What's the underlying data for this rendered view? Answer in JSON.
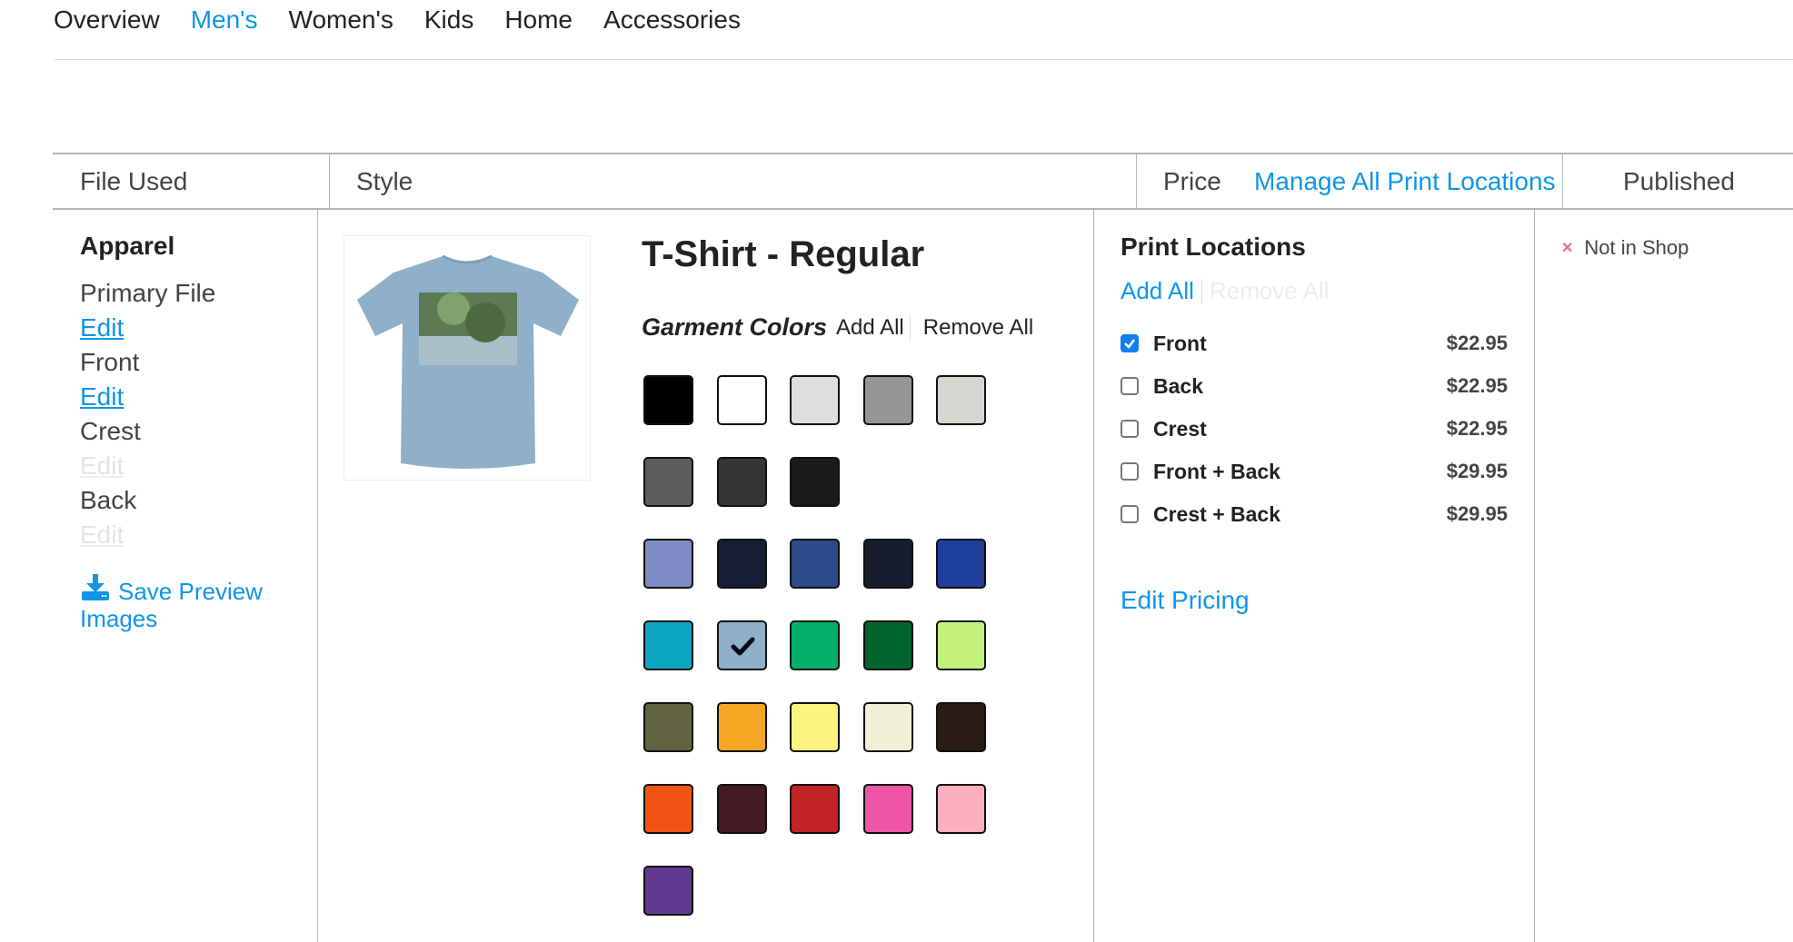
{
  "nav": {
    "tabs": [
      {
        "label": "Overview",
        "active": false
      },
      {
        "label": "Men's",
        "active": true
      },
      {
        "label": "Women's",
        "active": false
      },
      {
        "label": "Kids",
        "active": false
      },
      {
        "label": "Home",
        "active": false
      },
      {
        "label": "Accessories",
        "active": false
      }
    ]
  },
  "table_header": {
    "file_used": "File Used",
    "style": "Style",
    "price": "Price",
    "manage_all": "Manage All Print Locations",
    "published": "Published"
  },
  "file_used": {
    "section": "Apparel",
    "items": [
      {
        "label": "Primary File",
        "edit": "Edit",
        "enabled": true
      },
      {
        "label": "Front",
        "edit": "Edit",
        "enabled": true
      },
      {
        "label": "Crest",
        "edit": "Edit",
        "enabled": false
      },
      {
        "label": "Back",
        "edit": "Edit",
        "enabled": false
      }
    ],
    "save_preview": "Save Preview Images",
    "save_icon": "download-icon"
  },
  "style": {
    "product_title": "T-Shirt - Regular",
    "preview_shirt_color": "#8fb0c8",
    "garment_colors_label": "Garment Colors",
    "add_all": "Add All",
    "remove_all": "Remove All",
    "swatch_rows": [
      [
        {
          "color": "#000000"
        },
        {
          "color": "#ffffff"
        },
        {
          "color": "#dedede"
        },
        {
          "color": "#969696"
        },
        {
          "color": "#d6d5d2"
        }
      ],
      [
        {
          "color": "#5c5c5c"
        },
        {
          "color": "#333537"
        },
        {
          "color": "#1b1b1b"
        }
      ],
      [
        {
          "color": "#7f8bc4"
        },
        {
          "color": "#171d32"
        },
        {
          "color": "#2d4a8a"
        },
        {
          "color": "#171d2f"
        },
        {
          "color": "#203f9c"
        }
      ],
      [
        {
          "color": "#0ea5c2"
        },
        {
          "color": "#8fb0c8",
          "selected": true
        },
        {
          "color": "#03b06a"
        },
        {
          "color": "#04642e"
        },
        {
          "color": "#c3f27b"
        }
      ],
      [
        {
          "color": "#626340"
        },
        {
          "color": "#f4a624"
        },
        {
          "color": "#fcf47e"
        },
        {
          "color": "#f2efd9"
        },
        {
          "color": "#2a1b14"
        }
      ],
      [
        {
          "color": "#f05414"
        },
        {
          "color": "#451a25"
        },
        {
          "color": "#c32226"
        },
        {
          "color": "#f056a7"
        },
        {
          "color": "#fdaec0"
        }
      ],
      [
        {
          "color": "#5f3a8e"
        }
      ]
    ]
  },
  "print_locations": {
    "title": "Print Locations",
    "add_all": "Add All",
    "remove_all": "Remove All",
    "rows": [
      {
        "label": "Front",
        "price": "$22.95",
        "checked": true
      },
      {
        "label": "Back",
        "price": "$22.95",
        "checked": false
      },
      {
        "label": "Crest",
        "price": "$22.95",
        "checked": false
      },
      {
        "label": "Front + Back",
        "price": "$29.95",
        "checked": false
      },
      {
        "label": "Crest + Back",
        "price": "$29.95",
        "checked": false
      }
    ],
    "edit_pricing": "Edit Pricing"
  },
  "published": {
    "status": "Not in Shop",
    "status_icon": "x-icon"
  },
  "colors": {
    "accent": "#0f95e8",
    "checkbox_on": "#0f7ef0"
  }
}
